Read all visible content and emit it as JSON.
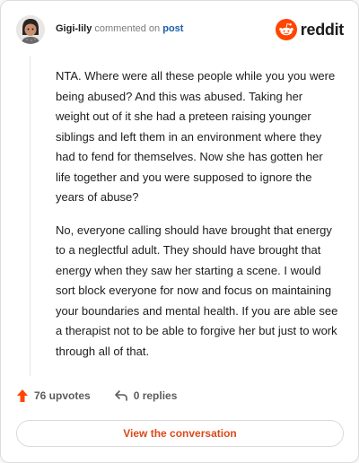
{
  "header": {
    "username": "Gigi-lily",
    "action_text": "commented on",
    "post_link": "post",
    "brand": "reddit"
  },
  "comment": {
    "paragraphs": [
      "NTA. Where were all these people while you you were being abused? And this was abused. Taking her weight out of it she had a preteen raising younger siblings and left them in an environment where they had to fend for themselves. Now she has gotten her life together and you were supposed to ignore the years of abuse?",
      "No, everyone calling should have brought that energy to a neglectful adult. They should have brought that energy when they saw her starting a scene. I would sort block everyone for now and focus on maintaining your boundaries and mental health. If you are able see a therapist not to be able to forgive her but just to work through all of that."
    ]
  },
  "actions": {
    "upvotes": "76 upvotes",
    "replies": "0 replies"
  },
  "view_button": "View the conversation",
  "icons": {
    "upvote": "upvote-arrow-icon",
    "reply": "reply-arrow-icon",
    "logo": "reddit-snoo-icon"
  },
  "colors": {
    "accent": "#ff4500",
    "link": "#1a5fa8",
    "button_text": "#d94a1a"
  }
}
